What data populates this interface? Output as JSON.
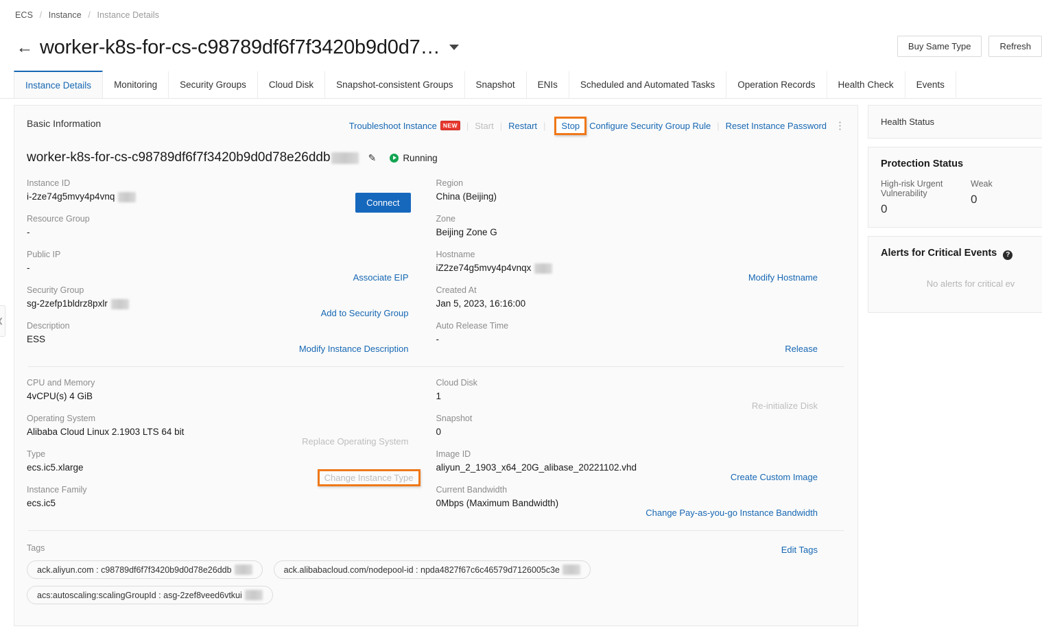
{
  "breadcrumb": {
    "root": "ECS",
    "parent": "Instance",
    "current": "Instance Details"
  },
  "header": {
    "back_icon": "back-arrow-icon",
    "title": "worker-k8s-for-cs-c98789df6f7f3420b9d0d7…",
    "caret_icon": "chevron-down-icon",
    "buy_same_type_label": "Buy Same Type",
    "refresh_label": "Refresh"
  },
  "tabs": [
    {
      "label": "Instance Details",
      "active": true
    },
    {
      "label": "Monitoring",
      "active": false
    },
    {
      "label": "Security Groups",
      "active": false
    },
    {
      "label": "Cloud Disk",
      "active": false
    },
    {
      "label": "Snapshot-consistent Groups",
      "active": false
    },
    {
      "label": "Snapshot",
      "active": false
    },
    {
      "label": "ENIs",
      "active": false
    },
    {
      "label": "Scheduled and Automated Tasks",
      "active": false
    },
    {
      "label": "Operation Records",
      "active": false
    },
    {
      "label": "Health Check",
      "active": false
    },
    {
      "label": "Events",
      "active": false
    }
  ],
  "basic_info": {
    "section_title": "Basic Information",
    "actions": {
      "troubleshoot": "Troubleshoot Instance",
      "new_badge": "NEW",
      "start": "Start",
      "restart": "Restart",
      "stop": "Stop",
      "configure_sg_rule": "Configure Security Group Rule",
      "reset_password": "Reset Instance Password",
      "more_icon": "more-vertical-icon"
    },
    "instance_name": "worker-k8s-for-cs-c98789df6f7f3420b9d0d78e26ddb",
    "edit_icon": "edit-pencil-icon",
    "status": "Running",
    "status_icon": "running-play-icon",
    "connect_label": "Connect",
    "left_items": [
      {
        "label": "Instance ID",
        "value": "i-2ze74g5mvy4p4vnq",
        "redacted": true,
        "redact_w": 28
      },
      {
        "label": "Resource Group",
        "value": "-",
        "redacted": false
      },
      {
        "label": "Public IP",
        "value": "-",
        "redacted": false,
        "action": "Associate EIP"
      },
      {
        "label": "Security Group",
        "value": "sg-2zefp1bldrz8pxlr",
        "redacted": true,
        "redact_w": 28,
        "action": "Add to Security Group"
      },
      {
        "label": "Description",
        "value": "ESS",
        "redacted": false,
        "action": "Modify Instance Description"
      }
    ],
    "right_items": [
      {
        "label": "Region",
        "value": "China (Beijing)",
        "redacted": false
      },
      {
        "label": "Zone",
        "value": "Beijing Zone G",
        "redacted": false
      },
      {
        "label": "Hostname",
        "value": "iZ2ze74g5mvy4p4vnqx",
        "redacted": true,
        "redact_w": 28,
        "action": "Modify Hostname"
      },
      {
        "label": "Created At",
        "value": "Jan 5, 2023, 16:16:00",
        "redacted": false
      },
      {
        "label": "Auto Release Time",
        "value": "-",
        "redacted": false,
        "action": "Release"
      }
    ]
  },
  "config_info": {
    "left_items": [
      {
        "label": "CPU and Memory",
        "value": "4vCPU(s) 4 GiB"
      },
      {
        "label": "Operating System",
        "value": "Alibaba Cloud Linux 2.1903 LTS 64 bit",
        "action": "Replace Operating System",
        "disabled": true
      },
      {
        "label": "Type",
        "value": "ecs.ic5.xlarge",
        "action": "Change Instance Type",
        "disabled": true,
        "highlighted": true
      },
      {
        "label": "Instance Family",
        "value": "ecs.ic5"
      }
    ],
    "right_items": [
      {
        "label": "Cloud Disk",
        "value": "1",
        "action": "Re-initialize Disk",
        "disabled": true
      },
      {
        "label": "Snapshot",
        "value": "0"
      },
      {
        "label": "Image ID",
        "value": "aliyun_2_1903_x64_20G_alibase_20221102.vhd",
        "action": "Create Custom Image"
      },
      {
        "label": "Current Bandwidth",
        "value": "0Mbps (Maximum Bandwidth)",
        "action": "Change Pay-as-you-go Instance Bandwidth"
      }
    ]
  },
  "tags": {
    "label": "Tags",
    "edit_label": "Edit Tags",
    "rows": [
      [
        {
          "text": "ack.aliyun.com : c98789df6f7f3420b9d0d78e26ddb",
          "redact_w": 26
        },
        {
          "text": "ack.alibabacloud.com/nodepool-id : npda4827f67c6c46579d7126005c3e",
          "redact_w": 26
        }
      ],
      [
        {
          "text": "acs:autoscaling:scalingGroupId : asg-2zef8veed6vtkui",
          "redact_w": 26
        }
      ]
    ]
  },
  "sidebar": {
    "health_status_title": "Health Status",
    "protection_title": "Protection Status",
    "protection_items": [
      {
        "name": "High-risk Urgent Vulnerability",
        "value": "0"
      },
      {
        "name": "Weak",
        "value": "0"
      }
    ],
    "alerts_title": "Alerts for Critical Events",
    "alerts_help_icon": "help-circle-icon",
    "alerts_empty": "No alerts for critical ev"
  },
  "colors": {
    "link": "#1667b3",
    "primary_button": "#1668bd",
    "highlight": "#f07818",
    "running_green": "#13a452",
    "new_badge_red": "#e8392f"
  }
}
